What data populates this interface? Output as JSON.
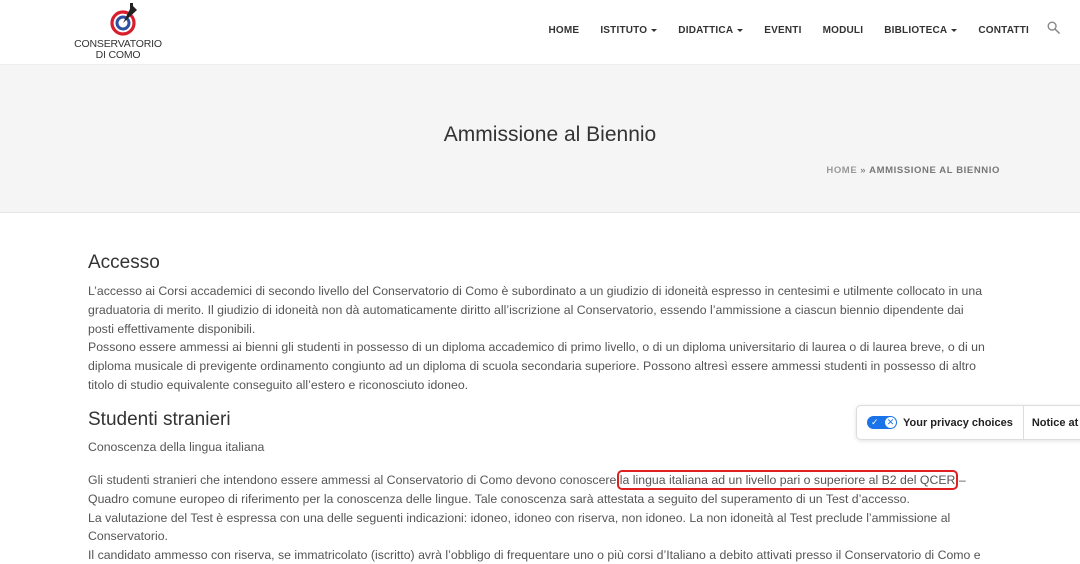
{
  "brand": {
    "logo_text_line1": "CONSERVATORIO",
    "logo_text_line2": "DI COMO",
    "colors": {
      "red": "#d81e2b",
      "blue": "#2f4fa0",
      "black": "#222222"
    }
  },
  "nav": {
    "items": [
      {
        "label": "HOME",
        "dropdown": false
      },
      {
        "label": "ISTITUTO",
        "dropdown": true
      },
      {
        "label": "DIDATTICA",
        "dropdown": true
      },
      {
        "label": "EVENTI",
        "dropdown": false
      },
      {
        "label": "MODULI",
        "dropdown": false
      },
      {
        "label": "BIBLIOTECA",
        "dropdown": true
      },
      {
        "label": "CONTATTI",
        "dropdown": false
      }
    ],
    "search_icon": "search-icon"
  },
  "page": {
    "title": "Ammissione al Biennio",
    "breadcrumb": {
      "home": "HOME",
      "separator": "»",
      "current": "AMMISSIONE AL BIENNIO"
    }
  },
  "content": {
    "accesso": {
      "heading": "Accesso",
      "p1": "L’accesso ai Corsi accademici di secondo livello del Conservatorio di Como è subordinato a un giudizio di idoneità espresso in centesimi e utilmente collocato in una graduatoria di merito. Il giudizio di idoneità non dà automaticamente diritto all’iscrizione al Conservatorio, essendo l’ammissione a ciascun biennio dipendente dai posti effettivamente disponibili.",
      "p2": "Possono essere ammessi ai bienni gli studenti in possesso di un diploma accademico di primo livello, o di un diploma universitario di laurea o di laurea breve, o di un diploma musicale di previgente ordinamento congiunto ad un diploma di scuola secondaria superiore. Possono altresì essere ammessi studenti in possesso di altro titolo di studio equivalente conseguito all’estero e riconosciuto idoneo."
    },
    "stranieri": {
      "heading": "Studenti stranieri",
      "subtitle": "Conoscenza della lingua italiana",
      "p_before": "Gli studenti stranieri che intendono essere ammessi al Conservatorio di Como devono conoscere ",
      "p_highlight": "la lingua italiana ad un livello pari o superiore al B2 del QCER",
      "p_after": " – Quadro comune europeo di riferimento per la conoscenza delle lingue. Tale conoscenza sarà attestata a seguito del superamento di un Test d’accesso.",
      "p_line2": "La valutazione del Test è espressa con una delle seguenti indicazioni: idoneo, idoneo con riserva, non idoneo. La non idoneità al Test preclude l’ammissione al Conservatorio.",
      "p_line3": "Il candidato ammesso con riserva, se immatricolato (iscritto) avrà l’obbligo di frequentare uno o più corsi d’Italiano a debito attivati presso il Conservatorio di Como e di superare il/i relativo/i esame/i di verifica."
    }
  },
  "privacy": {
    "label": "Your privacy choices",
    "notice": "Notice at c",
    "toggle_color": "#1a73e8"
  }
}
